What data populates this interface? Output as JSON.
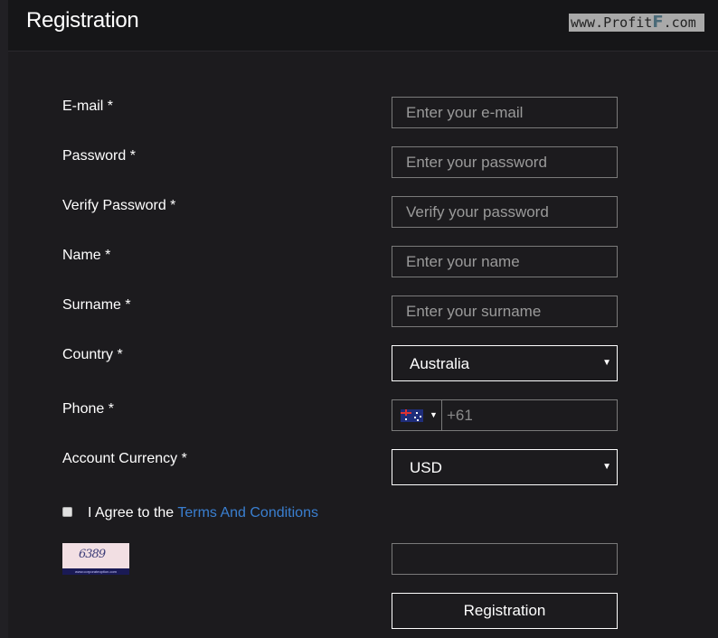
{
  "header": {
    "title": "Registration"
  },
  "watermark": {
    "prefix": "www.Profit",
    "f": "F",
    "suffix": ".com"
  },
  "form": {
    "email": {
      "label": "E-mail *",
      "placeholder": "Enter your e-mail"
    },
    "password": {
      "label": "Password *",
      "placeholder": "Enter your password"
    },
    "verify_password": {
      "label": "Verify Password *",
      "placeholder": "Verify your password"
    },
    "name": {
      "label": "Name *",
      "placeholder": "Enter your name"
    },
    "surname": {
      "label": "Surname *",
      "placeholder": "Enter your surname"
    },
    "country": {
      "label": "Country *",
      "value": "Australia",
      "arrow": "▼"
    },
    "phone": {
      "label": "Phone *",
      "country_flag": "australia-flag-icon",
      "arrow": "▼",
      "value": "+61"
    },
    "currency": {
      "label": "Account Currency *",
      "value": "USD",
      "arrow": "▼"
    },
    "agree": {
      "text": "I Agree to the ",
      "link": "Terms And Conditions",
      "checked": false
    },
    "captcha": {
      "code": "6389",
      "caption": "www.corporateoption.com",
      "input_value": ""
    },
    "submit_label": "Registration"
  }
}
